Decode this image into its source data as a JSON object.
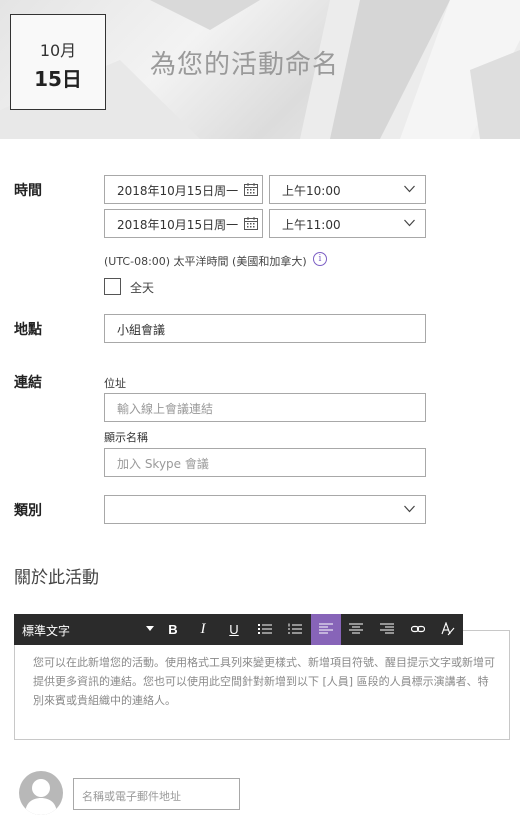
{
  "header": {
    "month": "10月",
    "day": "15日",
    "title": "為您的活動命名"
  },
  "time": {
    "label": "時間",
    "start_date": "2018年10月15日周一",
    "start_time": "上午10:00",
    "end_date": "2018年10月15日周一",
    "end_time": "上午11:00",
    "timezone": "(UTC-08:00) 太平洋時間 (美國和加拿大)",
    "all_day_label": "全天"
  },
  "location": {
    "label": "地點",
    "value": "小組會議"
  },
  "link": {
    "label": "連結",
    "address_label": "位址",
    "address_placeholder": "輸入線上會議連結",
    "display_label": "顯示名稱",
    "display_placeholder": "加入 Skype 會議"
  },
  "category": {
    "label": "類別",
    "value": ""
  },
  "about": {
    "title": "關於此活動",
    "toolbar_style": "標準文字",
    "body_text": "您可以在此新增您的活動。使用格式工具列來變更樣式、新增項目符號、醒目提示文字或新增可提供更多資訊的連結。您也可以使用此空間針對新增到以下 [人員] 區段的人員標示演講者、特別來賓或貴組織中的連絡人。"
  },
  "people": {
    "placeholder": "名稱或電子郵件地址"
  },
  "colors": {
    "accent": "#8764b8",
    "toolbar": "#2b2b2b"
  }
}
